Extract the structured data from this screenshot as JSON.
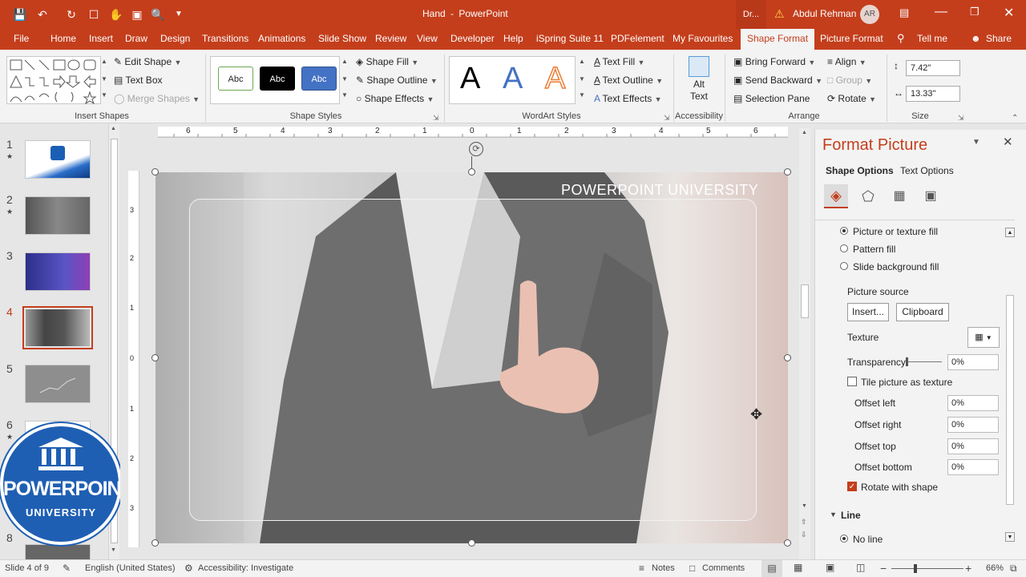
{
  "title": {
    "doc": "Hand",
    "separator": "-",
    "app": "PowerPoint",
    "search_stub": "Dr...",
    "user": "Abdul Rehman",
    "avatar": "AR"
  },
  "tabs": [
    "File",
    "Home",
    "Insert",
    "Draw",
    "Design",
    "Transitions",
    "Animations",
    "Slide Show",
    "Review",
    "View",
    "Developer",
    "Help",
    "iSpring Suite 11",
    "PDFelement",
    "My Favourites",
    "Shape Format",
    "Picture Format",
    "Tell me",
    "Share"
  ],
  "ribbon": {
    "insert_shapes": {
      "label": "Insert Shapes",
      "edit_shape": "Edit Shape",
      "text_box": "Text Box",
      "merge_shapes": "Merge Shapes"
    },
    "shape_styles": {
      "label": "Shape Styles",
      "swatches": [
        "Abc",
        "Abc",
        "Abc"
      ],
      "fill": "Shape Fill",
      "outline": "Shape Outline",
      "effects": "Shape Effects"
    },
    "wordart": {
      "label": "WordArt Styles",
      "letters": [
        "A",
        "A",
        "A"
      ],
      "text_fill": "Text Fill",
      "text_outline": "Text Outline",
      "text_effects": "Text Effects"
    },
    "accessibility": {
      "label": "Accessibility",
      "alt_text": "Alt Text"
    },
    "arrange": {
      "label": "Arrange",
      "bring_forward": "Bring Forward",
      "send_backward": "Send Backward",
      "selection_pane": "Selection Pane",
      "align": "Align",
      "group": "Group",
      "rotate": "Rotate"
    },
    "size": {
      "label": "Size",
      "height": "7.42\"",
      "width": "13.33\""
    }
  },
  "ruler": {
    "h_ticks": [
      "6",
      "5",
      "4",
      "3",
      "2",
      "1",
      "0",
      "1",
      "2",
      "3",
      "4",
      "5",
      "6"
    ],
    "v_ticks": [
      "3",
      "2",
      "1",
      "0",
      "1",
      "2",
      "3"
    ]
  },
  "slides": [
    {
      "num": "1",
      "star": "★"
    },
    {
      "num": "2",
      "star": "★"
    },
    {
      "num": "3",
      "star": ""
    },
    {
      "num": "4",
      "star": ""
    },
    {
      "num": "5",
      "star": ""
    },
    {
      "num": "6",
      "star": "★"
    },
    {
      "num": "8",
      "star": ""
    }
  ],
  "logo": {
    "line1": "POWERPOINT",
    "line2": "UNIVERSITY"
  },
  "slide_text": "POWERPOINT UNIVERSITY",
  "pane": {
    "title": "Format Picture",
    "tab1": "Shape Options",
    "tab2": "Text Options",
    "fill_options": [
      "Picture or texture fill",
      "Pattern fill",
      "Slide background fill"
    ],
    "picture_source": "Picture source",
    "insert": "Insert...",
    "clipboard": "Clipboard",
    "texture": "Texture",
    "transparency": "Transparency",
    "transparency_val": "0%",
    "tile": "Tile picture as texture",
    "offsets": [
      {
        "label": "Offset left",
        "val": "0%"
      },
      {
        "label": "Offset right",
        "val": "0%"
      },
      {
        "label": "Offset top",
        "val": "0%"
      },
      {
        "label": "Offset bottom",
        "val": "0%"
      }
    ],
    "rotate_with_shape": "Rotate with shape",
    "line_section": "Line",
    "no_line": "No line"
  },
  "status": {
    "slide": "Slide 4 of 9",
    "language": "English (United States)",
    "accessibility": "Accessibility: Investigate",
    "notes": "Notes",
    "comments": "Comments",
    "zoom": "66%"
  },
  "colors": {
    "accent": "#c43e1c"
  }
}
